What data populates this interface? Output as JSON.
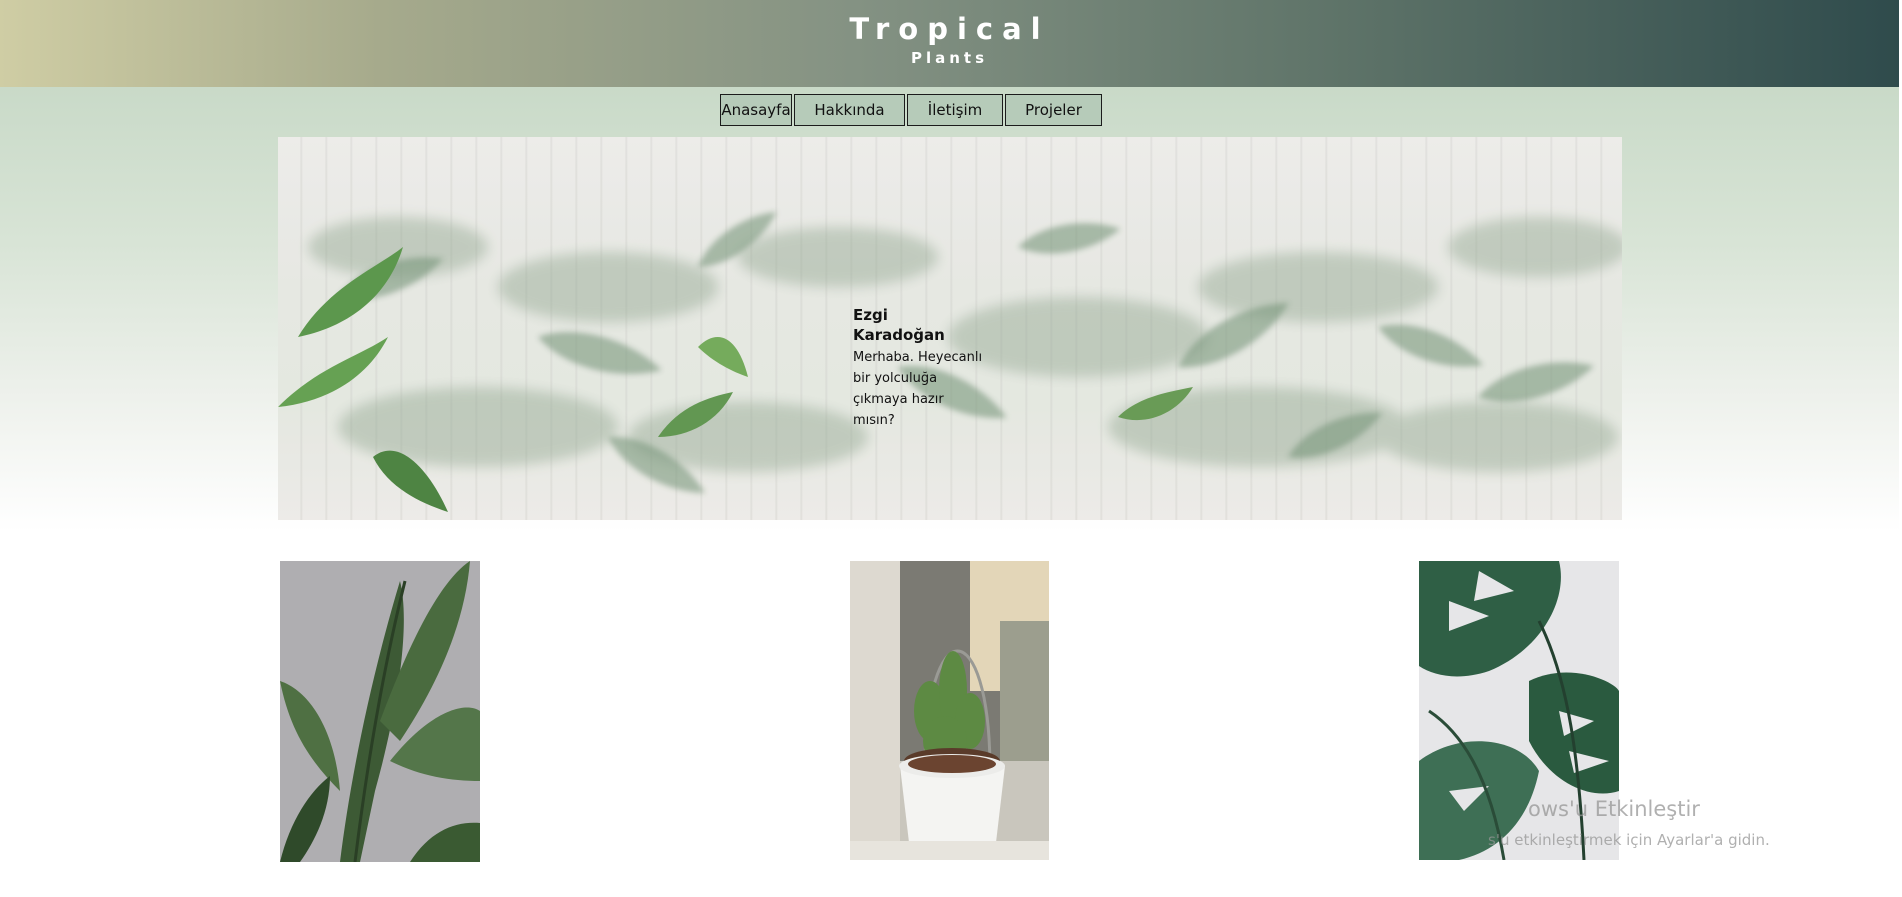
{
  "header": {
    "title": "Tropical",
    "subtitle": "Plants",
    "gradient_start": "#cfcda4",
    "gradient_end": "#2f4b4c"
  },
  "nav": {
    "items": [
      {
        "label": "Anasayfa"
      },
      {
        "label": "Hakkında"
      },
      {
        "label": "İletişim"
      },
      {
        "label": "Projeler"
      }
    ],
    "item_color": "#b6cbb9"
  },
  "hero": {
    "name": "Ezgi Karadoğan",
    "message": "Merhaba. Heyecanlı bir yolculuğa çıkmaya hazır mısın?",
    "image": "frosted-glass-tropical-leaves"
  },
  "gallery": {
    "photos": [
      {
        "image": "banana-leaf-plant"
      },
      {
        "image": "potted-cactus"
      },
      {
        "image": "monstera-leaf"
      }
    ]
  },
  "watermark": {
    "title": "ows'u Etkinleştir",
    "subtitle": "s'u etkinleştirmek için Ayarlar'a gidin."
  }
}
